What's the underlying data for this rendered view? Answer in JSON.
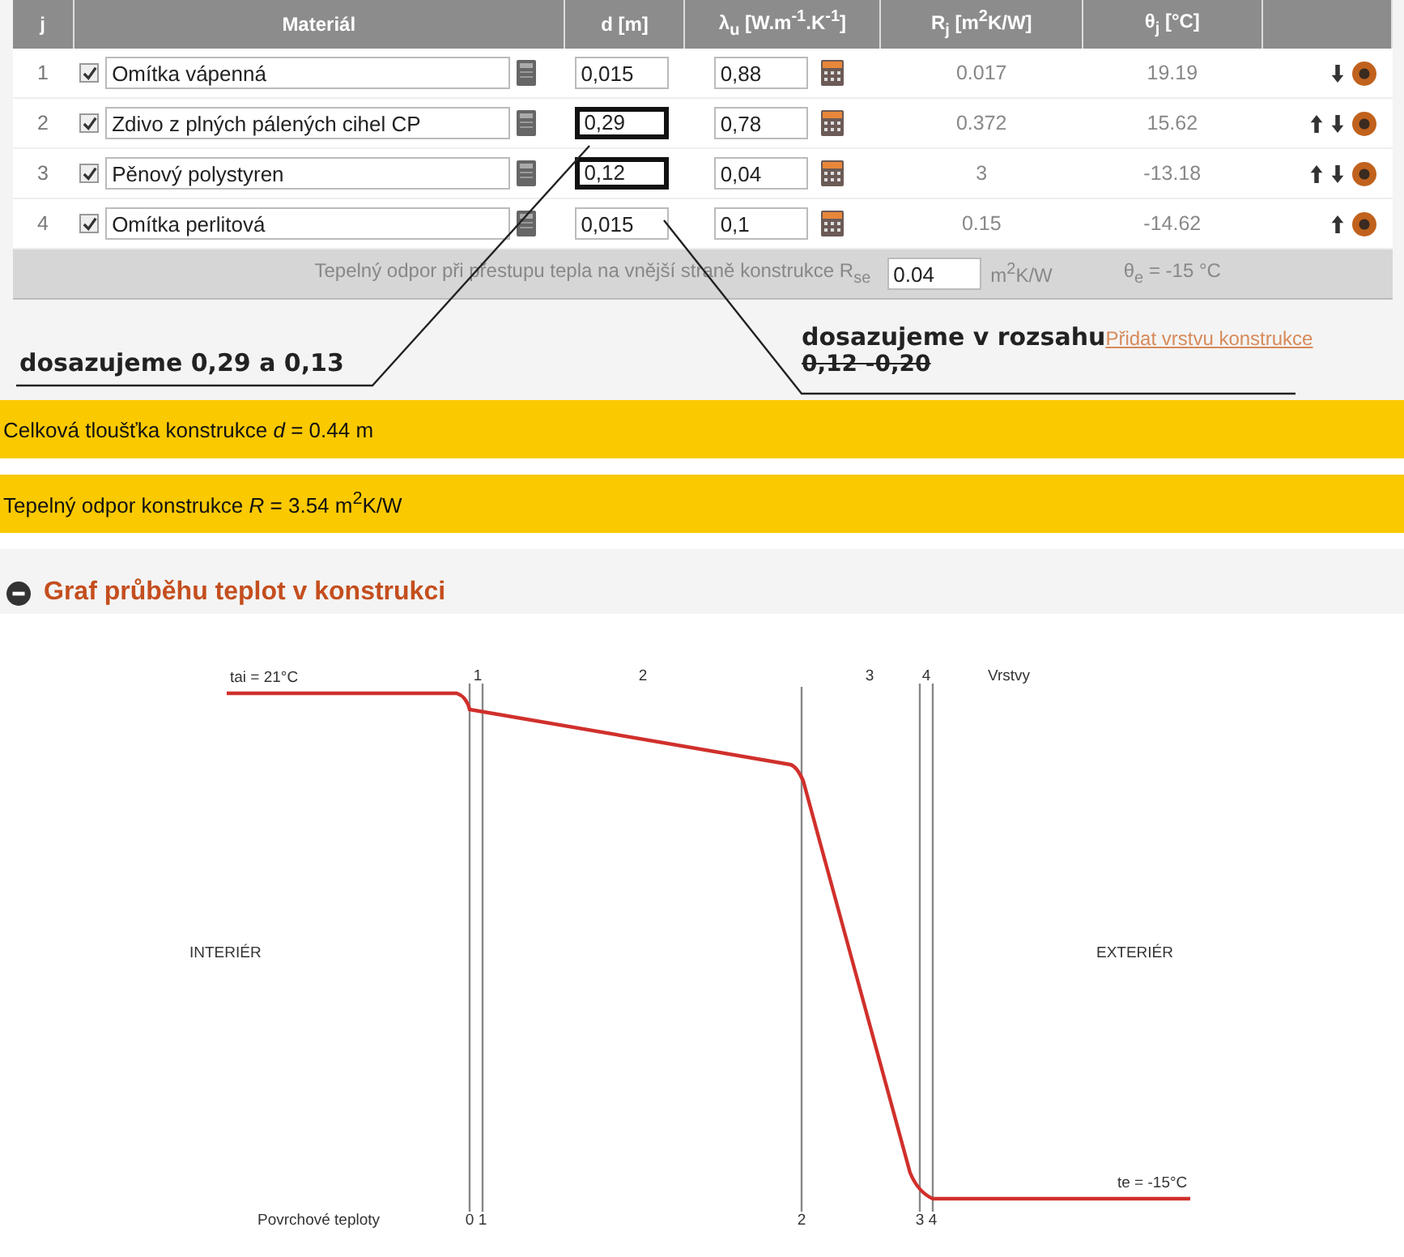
{
  "table": {
    "columns": [
      "j",
      "Materiál",
      "d [m]",
      "λ$_{u}$ [W.m$^{-1}$.K$^{-1}$]",
      "R$_{j}$ [m$^{2}$K/W]",
      "θ$_{j}$ [°C]"
    ],
    "rows": [
      {
        "index": "1",
        "checked": true,
        "material": "Omítka vápenná",
        "d": "0,015",
        "outlined": false,
        "lambda": "0,88",
        "r": "0.017",
        "theta": "19.19",
        "move_up": false,
        "move_down": true
      },
      {
        "index": "2",
        "checked": true,
        "material": "Zdivo z plných pálených cihel CP",
        "d": "0,29",
        "outlined": true,
        "lambda": "0,78",
        "r": "0.372",
        "theta": "15.62",
        "move_up": true,
        "move_down": true
      },
      {
        "index": "3",
        "checked": true,
        "material": "Pěnový polystyren",
        "d": "0,12",
        "outlined": true,
        "lambda": "0,04",
        "r": "3",
        "theta": "-13.18",
        "move_up": true,
        "move_down": true
      },
      {
        "index": "4",
        "checked": true,
        "material": "Omítka perlitová",
        "d": "0,015",
        "outlined": false,
        "lambda": "0,1",
        "r": "0.15",
        "theta": "-14.62",
        "move_up": true,
        "move_down": false
      }
    ],
    "footer": {
      "label": "Tepelný odpor při přestupu tepla na vnější straně konstrukce R$_{se}$",
      "value": "0.04",
      "unit": "m$^{2}$K/W",
      "theta_e": "θ$_{e}$ = -15 °C"
    }
  },
  "annotations": {
    "left": "dosazujeme 0,29 a  0,13",
    "right_1": "dosazujeme v rozsahu",
    "right_2": "0,12 -0,20"
  },
  "add_layer_link": "Přidat vrstvu konstrukce",
  "summary": [
    "Celková tloušťka konstrukce *d* = 0.44 m",
    "Tepelný odpor konstrukce *R* = 3.54 m$^{2}$K/W"
  ],
  "graph": {
    "heading": "Graf průběhu teplot v konstrukci",
    "labels": {
      "tai": "tai = 21°C",
      "layers": [
        "1",
        "2",
        "3",
        "4"
      ],
      "layers_title": "Vrstvy",
      "interior": "INTERIÉR",
      "exterior": "EXTERIÉR",
      "te": "te = -15°C",
      "surface_title": "Povrchové teploty",
      "surfaces": [
        "0 1",
        "2",
        "3 4"
      ]
    }
  }
}
